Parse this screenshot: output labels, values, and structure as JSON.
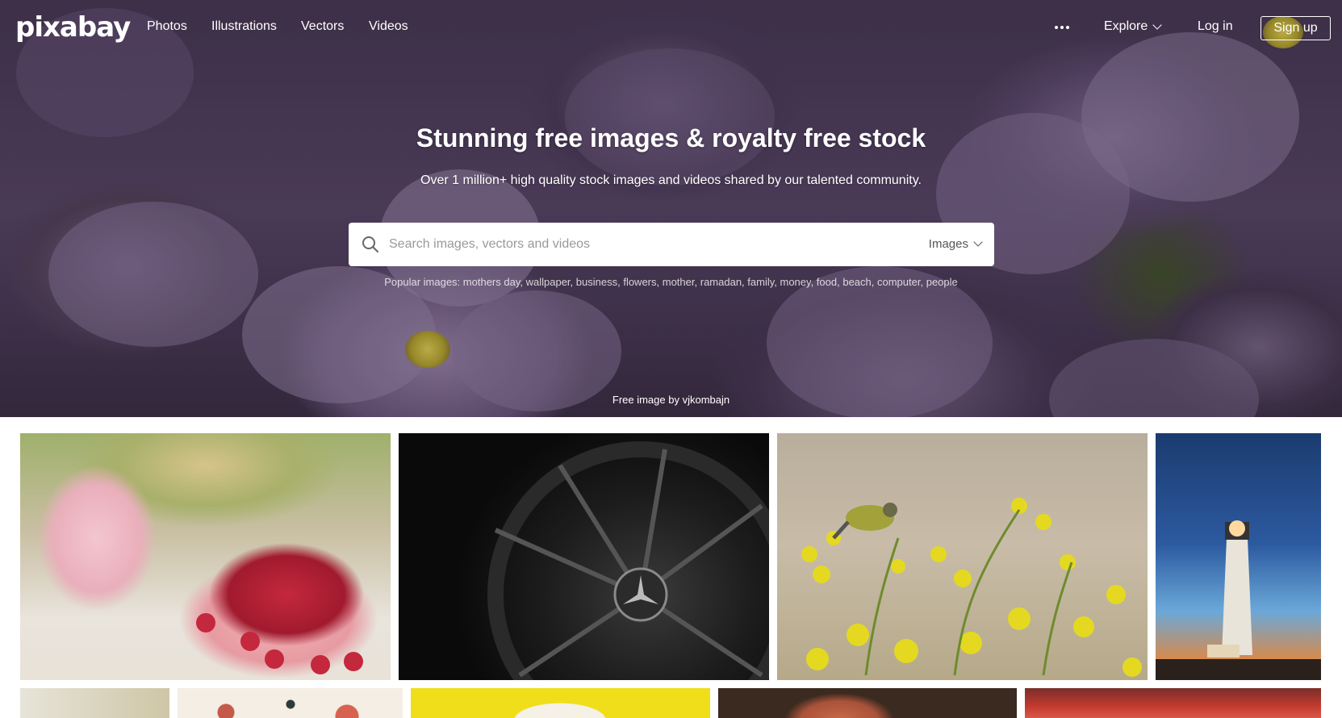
{
  "brand": {
    "logo": "pixabay"
  },
  "nav": {
    "links": [
      "Photos",
      "Illustrations",
      "Vectors",
      "Videos"
    ],
    "explore": "Explore",
    "login": "Log in",
    "signup": "Sign up"
  },
  "hero": {
    "title": "Stunning free images & royalty free stock",
    "subtitle": "Over 1 million+ high quality stock images and videos shared by our talented community.",
    "search_placeholder": "Search images, vectors and videos",
    "search_type": "Images",
    "popular_label": "Popular images:",
    "popular_terms": [
      "mothers day",
      "wallpaper",
      "business",
      "flowers",
      "mother",
      "ramadan",
      "family",
      "money",
      "food",
      "beach",
      "computer",
      "people"
    ],
    "credit": "Free image by vjkombajn"
  },
  "icons": {
    "search": "search-icon",
    "more": "more-dots-icon",
    "explore_chevron": "chevron-down-icon",
    "type_chevron": "chevron-down-icon"
  },
  "gallery": {
    "row1": [
      "raspberries-cup-photo",
      "car-wheel-photo",
      "bird-yellow-flowers-photo",
      "lighthouse-photo"
    ],
    "row2": [
      "plant-photo",
      "floral-pattern-photo",
      "yellow-bowl-photo",
      "portrait-photo",
      "tulips-photo"
    ]
  }
}
